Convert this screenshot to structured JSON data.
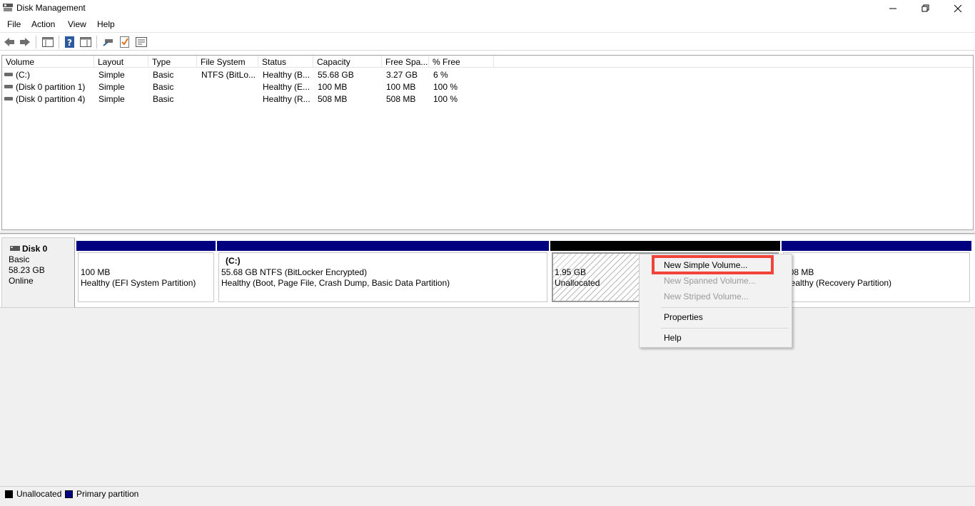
{
  "window": {
    "title": "Disk Management"
  },
  "menu": [
    "File",
    "Action",
    "View",
    "Help"
  ],
  "toolbar": {
    "icons": [
      "back-arrow-icon",
      "forward-arrow-icon",
      "console-tree-icon",
      "help-icon",
      "action-pane-icon",
      "connect-icon",
      "checklist-icon",
      "properties-icon"
    ]
  },
  "volumes": {
    "columns": [
      "Volume",
      "Layout",
      "Type",
      "File System",
      "Status",
      "Capacity",
      "Free Spa...",
      "% Free"
    ],
    "rows": [
      {
        "volume": " (C:)",
        "layout": "Simple",
        "type": "Basic",
        "fs": "NTFS (BitLo...",
        "status": "Healthy (B...",
        "capacity": "55.68 GB",
        "free": "3.27 GB",
        "pct": "6 %"
      },
      {
        "volume": "(Disk 0 partition 1)",
        "layout": "Simple",
        "type": "Basic",
        "fs": "",
        "status": "Healthy (E...",
        "capacity": "100 MB",
        "free": "100 MB",
        "pct": "100 %"
      },
      {
        "volume": "(Disk 0 partition 4)",
        "layout": "Simple",
        "type": "Basic",
        "fs": "",
        "status": "Healthy (R...",
        "capacity": "508 MB",
        "free": "508 MB",
        "pct": "100 %"
      }
    ]
  },
  "disk": {
    "name": "Disk 0",
    "type": "Basic",
    "size": "58.23 GB",
    "state": "Online",
    "partitions": [
      {
        "title": "",
        "size": "100 MB",
        "desc": "Healthy (EFI System Partition)"
      },
      {
        "title": "(C:)",
        "size": "55.68 GB NTFS (BitLocker Encrypted)",
        "desc": "Healthy (Boot, Page File, Crash Dump, Basic Data Partition)"
      },
      {
        "title": "",
        "size": "1.95 GB",
        "desc": "Unallocated"
      },
      {
        "title": "",
        "size": "508 MB",
        "desc": "Healthy (Recovery Partition)"
      }
    ]
  },
  "context_menu": {
    "items": [
      {
        "label": "New Simple Volume...",
        "enabled": true
      },
      {
        "label": "New Spanned Volume...",
        "enabled": false
      },
      {
        "label": "New Striped Volume...",
        "enabled": false
      },
      {
        "label": "Properties",
        "enabled": true
      },
      {
        "label": "Help",
        "enabled": true
      }
    ]
  },
  "legend": [
    {
      "label": "Unallocated",
      "color": "#000000"
    },
    {
      "label": "Primary partition",
      "color": "#000080"
    }
  ],
  "colors": {
    "primary_partition": "#000080",
    "unallocated": "#000000",
    "highlight": "#f0443a"
  }
}
